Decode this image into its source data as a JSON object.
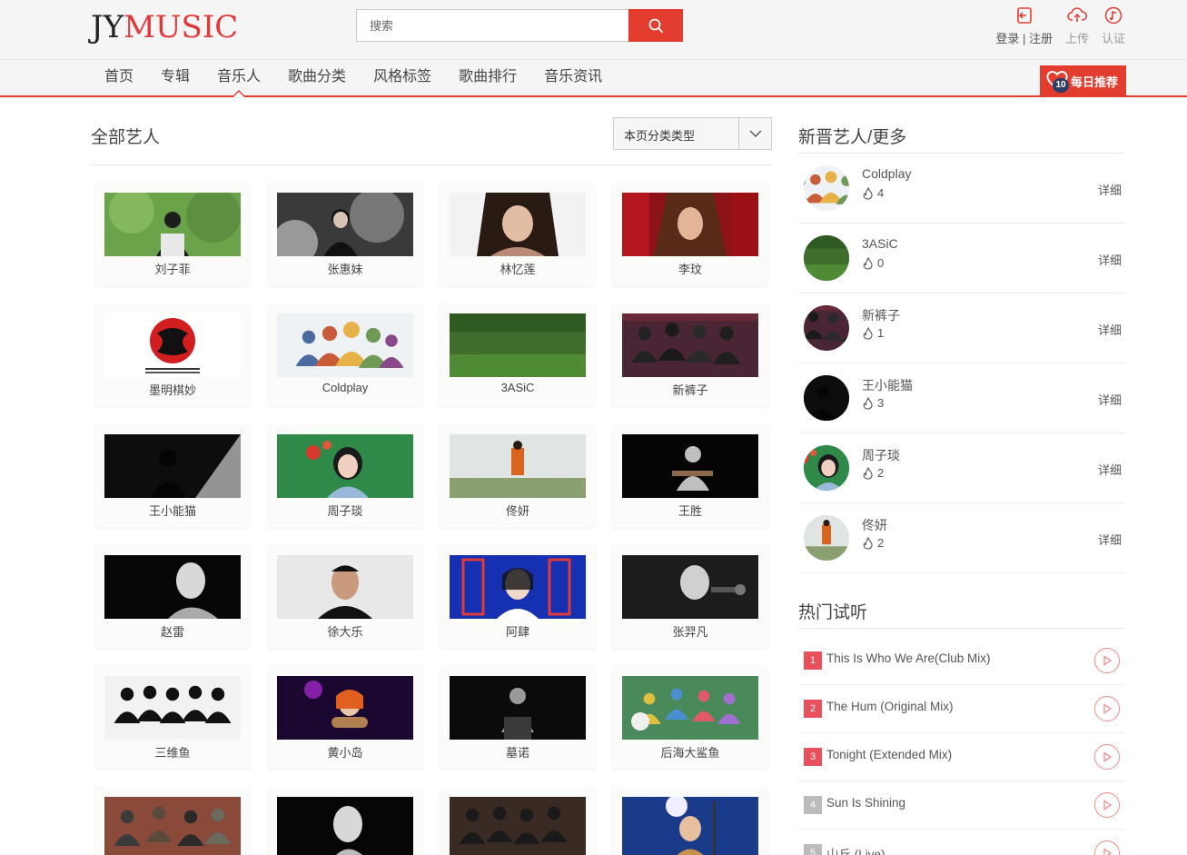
{
  "brand": {
    "logo_jy": "JY",
    "logo_music": "MUSIC"
  },
  "search": {
    "placeholder": "搜索"
  },
  "header_tools": {
    "login": "登录",
    "sep": " | ",
    "register": "注册",
    "upload": "上传",
    "verify": "认证"
  },
  "nav": {
    "items": [
      "首页",
      "专辑",
      "音乐人",
      "歌曲分类",
      "风格标签",
      "歌曲排行",
      "音乐资讯"
    ],
    "active_index": 2,
    "daily": {
      "label": "每日推荐",
      "badge": "10"
    }
  },
  "main": {
    "title": "全部艺人",
    "filter_label": "本页分类类型",
    "artists": [
      {
        "name": "刘子菲",
        "img": "green"
      },
      {
        "name": "张惠妹",
        "img": "bw"
      },
      {
        "name": "林忆莲",
        "img": "portrait"
      },
      {
        "name": "李玟",
        "img": "red"
      },
      {
        "name": "墨明棋妙",
        "img": "logo"
      },
      {
        "name": "Coldplay",
        "img": "band"
      },
      {
        "name": "3ASiC",
        "img": "grass"
      },
      {
        "name": "新裤子",
        "img": "stage"
      },
      {
        "name": "王小能猫",
        "img": "dark"
      },
      {
        "name": "周子琰",
        "img": "green2"
      },
      {
        "name": "佟妍",
        "img": "field"
      },
      {
        "name": "王胜",
        "img": "dark2"
      },
      {
        "name": "赵雷",
        "img": "dark3"
      },
      {
        "name": "徐大乐",
        "img": "man"
      },
      {
        "name": "阿肆",
        "img": "blue"
      },
      {
        "name": "张羿凡",
        "img": "mic"
      },
      {
        "name": "三维鱼",
        "img": "group"
      },
      {
        "name": "黄小岛",
        "img": "purple"
      },
      {
        "name": "墓诺",
        "img": "dark4"
      },
      {
        "name": "后海大鲨鱼",
        "img": "colorful"
      },
      {
        "name": "",
        "img": "street"
      },
      {
        "name": "",
        "img": "dark5"
      },
      {
        "name": "",
        "img": "band2"
      },
      {
        "name": "",
        "img": "stage2"
      }
    ]
  },
  "sidebar": {
    "new_artists_title": "新晋艺人/更多",
    "detail_label": "详细",
    "new_artists": [
      {
        "name": "Coldplay",
        "hot": "4",
        "img": "band"
      },
      {
        "name": "3ASiC",
        "hot": "0",
        "img": "grass"
      },
      {
        "name": "新裤子",
        "hot": "1",
        "img": "stage"
      },
      {
        "name": "王小能猫",
        "hot": "3",
        "img": "dark"
      },
      {
        "name": "周子琰",
        "hot": "2",
        "img": "green2"
      },
      {
        "name": "佟妍",
        "hot": "2",
        "img": "field"
      }
    ],
    "hot_title": "热门试听",
    "tracks": [
      {
        "num": "1",
        "name": "This Is Who We Are(Club Mix)",
        "color": "#e8505b"
      },
      {
        "num": "2",
        "name": "The Hum (Original Mix)",
        "color": "#e8505b"
      },
      {
        "num": "3",
        "name": "Tonight (Extended Mix)",
        "color": "#e8505b"
      },
      {
        "num": "4",
        "name": "Sun Is Shining",
        "color": "#bbbbbb"
      },
      {
        "num": "5",
        "name": "山丘 (Live)",
        "color": "#bbbbbb"
      }
    ]
  },
  "colors": {
    "accent": "#e23d2f"
  }
}
